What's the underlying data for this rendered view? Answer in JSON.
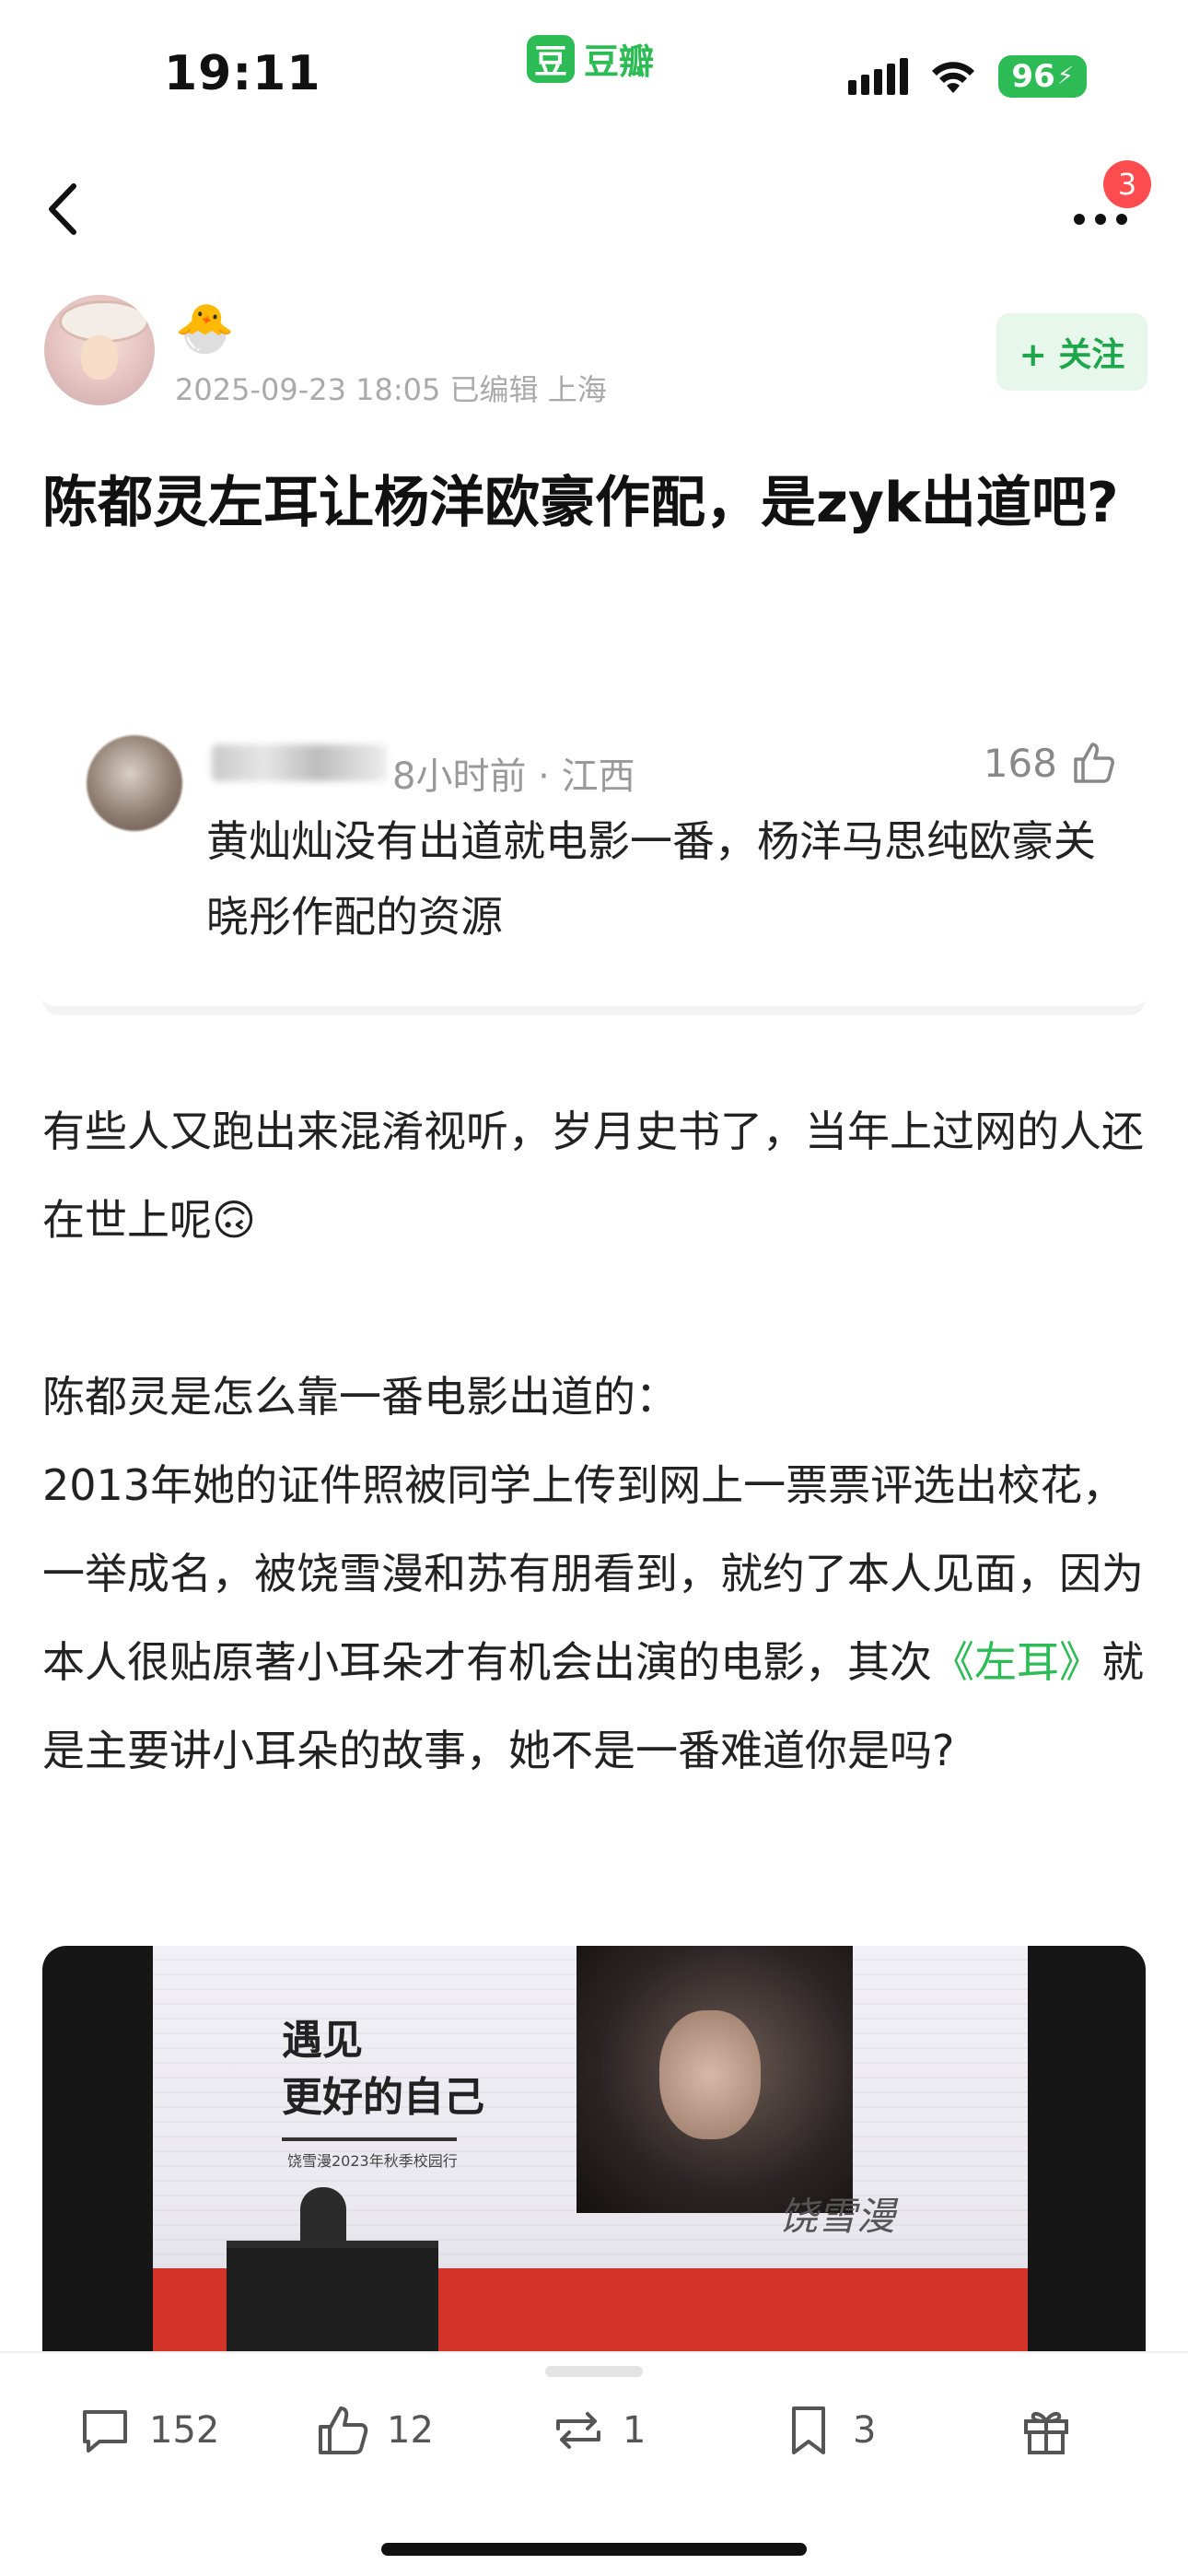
{
  "status_bar": {
    "time": "19:11",
    "app_logo_char": "豆",
    "app_name": "豆瓣",
    "battery": "96"
  },
  "nav": {
    "badge_count": "3"
  },
  "author": {
    "name_emoji": "🐣",
    "meta": "2025-09-23 18:05  已编辑  上海",
    "follow_label": "+ 关注"
  },
  "post": {
    "title": "陈都灵左耳让杨洋欧豪作配，是zyk出道吧?"
  },
  "quote": {
    "meta": "8小时前 · 江西",
    "likes": "168",
    "text": "黄灿灿没有出道就电影一番，杨洋马思纯欧豪关晓彤作配的资源"
  },
  "body": {
    "p1": "有些人又跑出来混淆视听，岁月史书了，当年上过网的人还在世上呢🙃",
    "p2_line1": "陈都灵是怎么靠一番电影出道的：",
    "p2_part1": "2013年她的证件照被同学上传到网上一票票评选出校花，一举成名，被饶雪漫和苏有朋看到，就约了本人见面，因为本人很贴原著小耳朵才有机会出演的电影，其次",
    "p2_link": "《左耳》",
    "p2_part2": "就是主要讲小耳朵的故事，她不是一番难道你是吗?"
  },
  "image": {
    "poster_title_line1": "遇见",
    "poster_title_line2": "更好的自己",
    "poster_sub": "饶雪漫2023年秋季校园行",
    "signature": "饶雪漫"
  },
  "actions": {
    "comments": "152",
    "likes": "12",
    "reshares": "1",
    "collects": "3"
  },
  "colors": {
    "accent": "#2dbb55",
    "badge": "#ff4d4f"
  }
}
